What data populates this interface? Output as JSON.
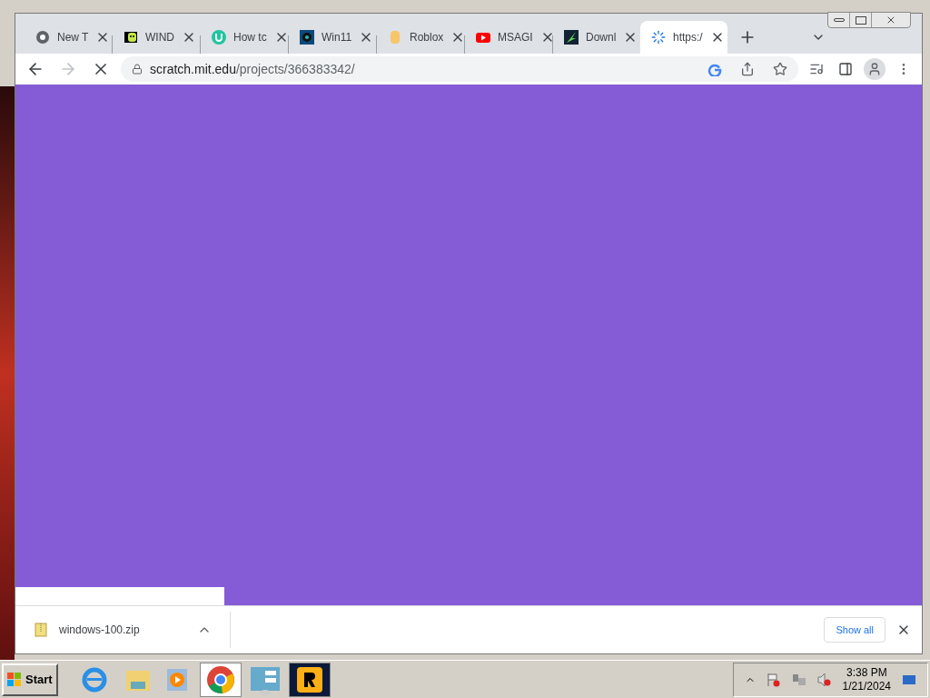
{
  "tabs": [
    {
      "title": "New T",
      "selected": false
    },
    {
      "title": "WIND",
      "selected": false
    },
    {
      "title": "How tc",
      "selected": false
    },
    {
      "title": "Win11",
      "selected": false
    },
    {
      "title": "Roblox",
      "selected": false
    },
    {
      "title": "MSAGI",
      "selected": false
    },
    {
      "title": "Downl",
      "selected": false
    },
    {
      "title": "https:/",
      "selected": true
    }
  ],
  "address": {
    "host": "scratch.mit.edu",
    "path": "/projects/366383342/"
  },
  "downloads": {
    "items": [
      {
        "filename": "windows-100.zip"
      }
    ],
    "show_all": "Show all"
  },
  "taskbar": {
    "start": "Start",
    "time": "3:38 PM",
    "date": "1/21/2024"
  }
}
